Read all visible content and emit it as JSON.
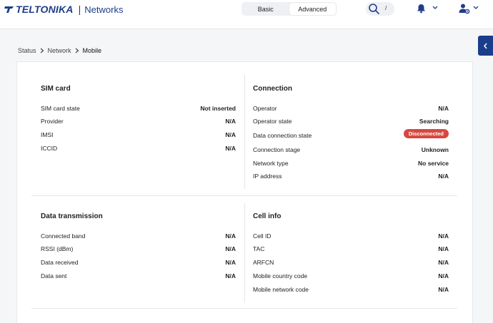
{
  "header": {
    "brand": "TELTONIKA",
    "separator": "|",
    "product": "Networks",
    "modes": [
      "Basic",
      "Advanced"
    ],
    "search_shortcut": "/"
  },
  "breadcrumb": [
    "Status",
    "Network",
    "Mobile"
  ],
  "sections": {
    "sim": {
      "title": "SIM card",
      "rows": [
        {
          "label": "SIM card state",
          "value": "Not inserted"
        },
        {
          "label": "Provider",
          "value": "N/A"
        },
        {
          "label": "IMSI",
          "value": "N/A"
        },
        {
          "label": "ICCID",
          "value": "N/A"
        }
      ]
    },
    "connection": {
      "title": "Connection",
      "rows": [
        {
          "label": "Operator",
          "value": "N/A"
        },
        {
          "label": "Operator state",
          "value": "Searching"
        },
        {
          "label": "Data connection state",
          "value": "Disconnected"
        },
        {
          "label": "Connection stage",
          "value": "Unknown"
        },
        {
          "label": "Network type",
          "value": "No service"
        },
        {
          "label": "IP address",
          "value": "N/A"
        }
      ]
    },
    "transmission": {
      "title": "Data transmission",
      "rows": [
        {
          "label": "Connected band",
          "value": "N/A"
        },
        {
          "label": "RSSI (dBm)",
          "value": "N/A"
        },
        {
          "label": "Data received",
          "value": "N/A"
        },
        {
          "label": "Data sent",
          "value": "N/A"
        }
      ]
    },
    "cell": {
      "title": "Cell info",
      "rows": [
        {
          "label": "Cell ID",
          "value": "N/A"
        },
        {
          "label": "TAC",
          "value": "N/A"
        },
        {
          "label": "ARFCN",
          "value": "N/A"
        },
        {
          "label": "Mobile country code",
          "value": "N/A"
        },
        {
          "label": "Mobile network code",
          "value": "N/A"
        }
      ]
    }
  },
  "colors": {
    "brand": "#1f3c88",
    "status_disconnected": "#d6483f"
  },
  "icons": {
    "search": "search-icon",
    "notifications": "bell-icon",
    "user": "user-settings-icon",
    "sidebar_toggle": "chevron-left-icon"
  }
}
